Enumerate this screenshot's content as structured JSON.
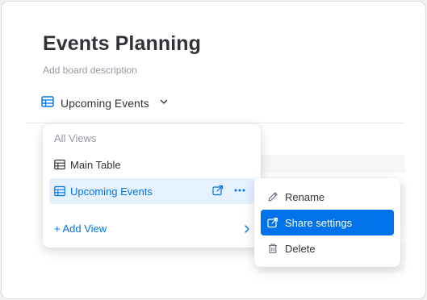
{
  "board": {
    "title": "Events Planning",
    "description": "Add board description"
  },
  "view_switcher": {
    "current_view": "Upcoming Events",
    "icon": "table-icon",
    "dropdown_icon": "chevron-down-icon"
  },
  "views_menu": {
    "section_title": "All Views",
    "items": [
      {
        "label": "Main Table",
        "icon": "table-icon",
        "selected": false
      },
      {
        "label": "Upcoming Events",
        "icon": "table-icon",
        "selected": true
      }
    ],
    "add_view_label": "+ Add View"
  },
  "context_menu": {
    "items": [
      {
        "label": "Rename",
        "icon": "pencil-icon",
        "active": false
      },
      {
        "label": "Share settings",
        "icon": "share-icon",
        "active": true
      },
      {
        "label": "Delete",
        "icon": "trash-icon",
        "active": false
      }
    ]
  },
  "colors": {
    "accent": "#0073ea",
    "selected_bg": "#e5f1ff",
    "text": "#323338",
    "muted": "#9699a6"
  }
}
